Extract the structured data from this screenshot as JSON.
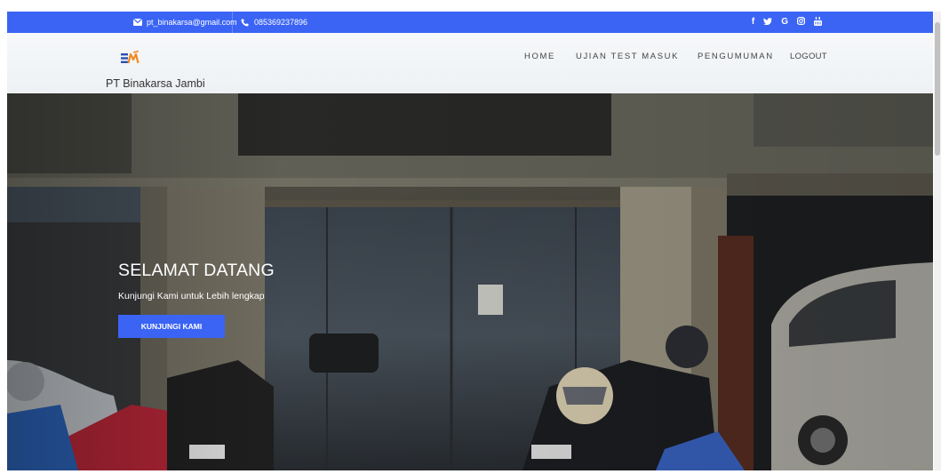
{
  "topbar": {
    "email": "pt_binakarsa@gmail.com",
    "phone": "085369237896",
    "social_icons": [
      "facebook-icon",
      "twitter-icon",
      "google-icon",
      "instagram-icon",
      "youtube-icon"
    ],
    "social_glyphs": [
      "f",
      "✔",
      "G",
      "◎",
      "▟"
    ]
  },
  "header": {
    "brand": "PT Binakarsa Jambi",
    "nav": {
      "home": "HOME",
      "ujian": "UJIAN TEST MASUK",
      "pengumuman": "PENGUMUMAN",
      "logout": "LOGOUT"
    }
  },
  "hero": {
    "title": "SELAMAT DATANG",
    "subtitle": "Kunjungi Kami untuk Lebih lengkap",
    "button": "KUNJUNGI KAMI"
  },
  "colors": {
    "accent": "#3b64f5",
    "header_bg": "#f4f6f8"
  }
}
